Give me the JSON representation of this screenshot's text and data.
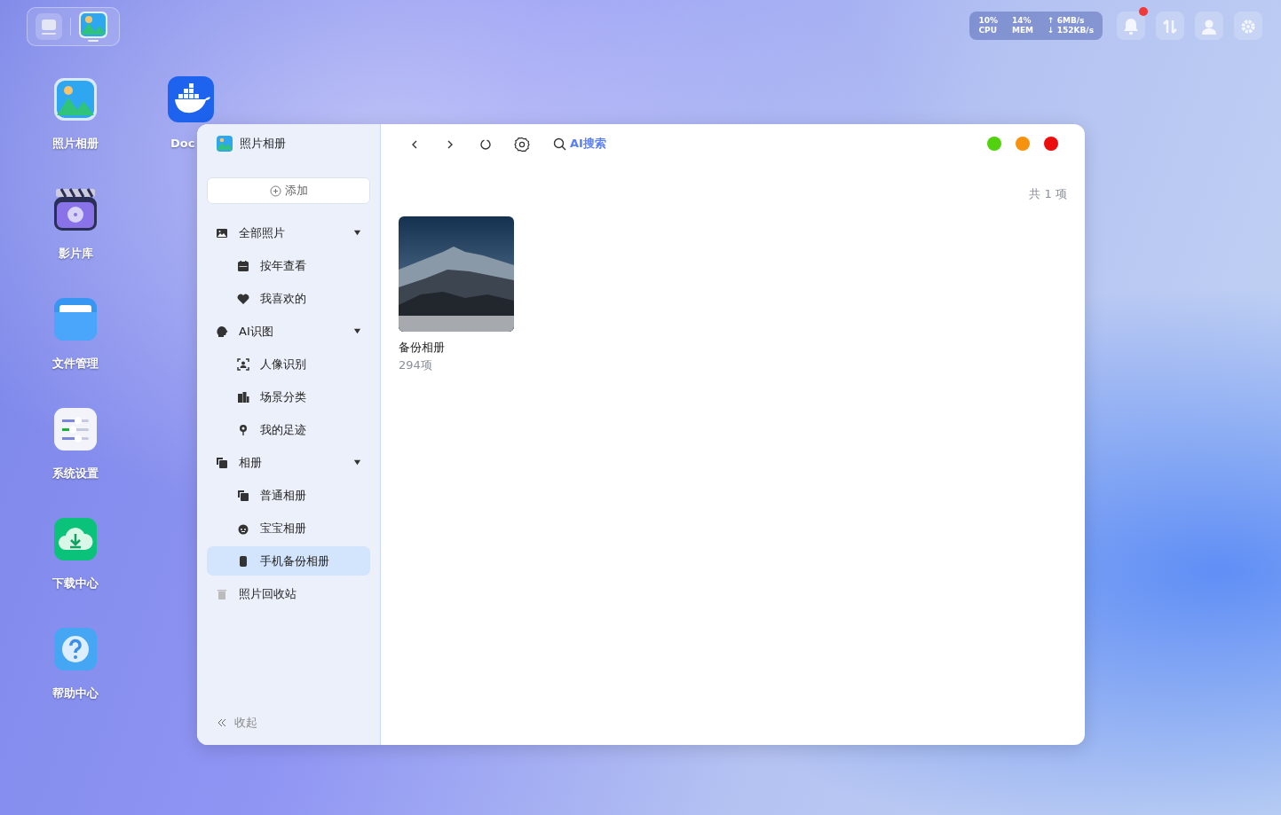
{
  "status": {
    "cpu": "10%",
    "cpu_label": "CPU",
    "mem": "14%",
    "mem_label": "MEM",
    "upload": "↑ 6MB/s",
    "download": "↓ 152KB/s"
  },
  "notifications": {
    "unread": true
  },
  "desktop_icons": [
    {
      "label": "照片相册"
    },
    {
      "label": "影片库"
    },
    {
      "label": "文件管理"
    },
    {
      "label": "系统设置"
    },
    {
      "label": "下载中心"
    },
    {
      "label": "帮助中心"
    }
  ],
  "desktop_icons_column_2": [
    {
      "label": "Doc"
    }
  ],
  "window": {
    "title": "照片相册",
    "add_button": "添加",
    "nav": [
      {
        "label": "全部照片",
        "selected": false,
        "expanded": true,
        "children": [
          {
            "label": "按年查看",
            "selected": false
          },
          {
            "label": "我喜欢的",
            "selected": false
          }
        ]
      },
      {
        "label": "AI识图",
        "selected": false,
        "expanded": true,
        "children": [
          {
            "label": "人像识别",
            "selected": false
          },
          {
            "label": "场景分类",
            "selected": false
          },
          {
            "label": "我的足迹",
            "selected": false
          }
        ]
      },
      {
        "label": "相册",
        "selected": false,
        "expanded": true,
        "children": [
          {
            "label": "普通相册",
            "selected": false
          },
          {
            "label": "宝宝相册",
            "selected": false
          },
          {
            "label": "手机备份相册",
            "selected": true
          }
        ]
      },
      {
        "label": "照片回收站",
        "selected": false
      }
    ],
    "collapse": "收起",
    "search": "AI搜索",
    "count": "共 1 项",
    "albums": [
      {
        "title": "备份相册",
        "count": "294项"
      }
    ]
  }
}
